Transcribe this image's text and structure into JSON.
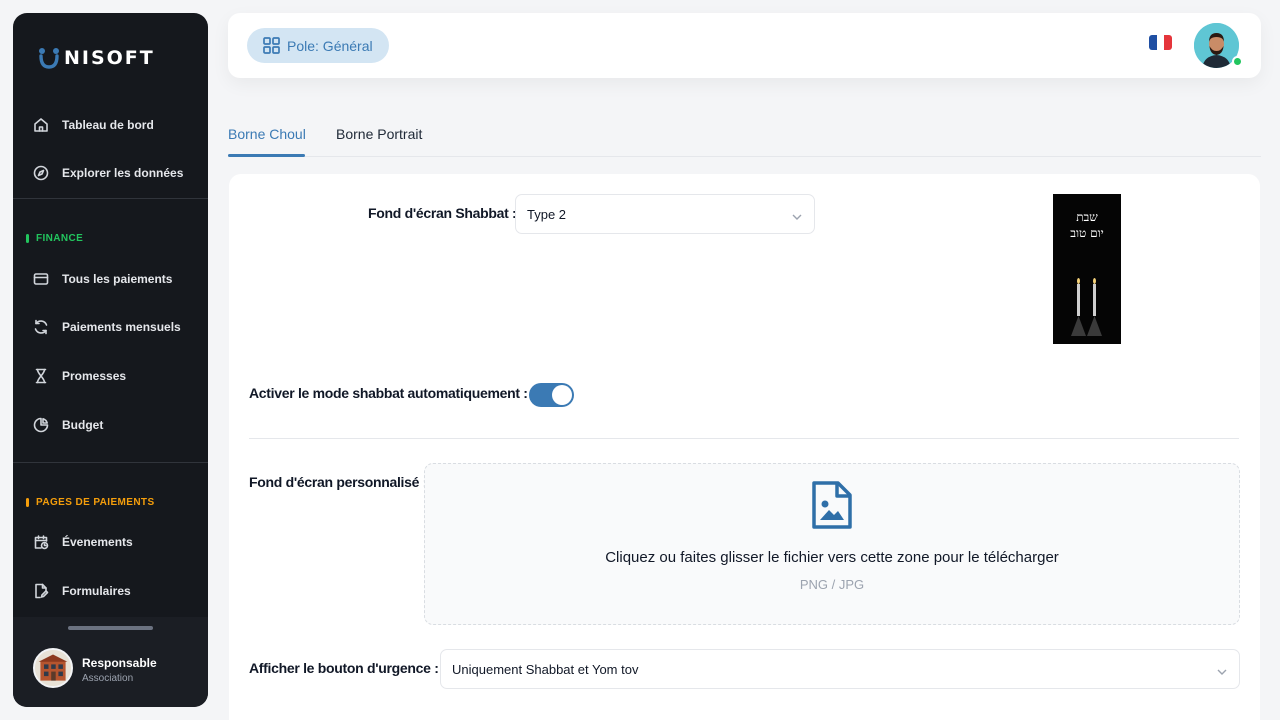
{
  "brand": {
    "name": "NISOFT",
    "accent": "#3b7ab4"
  },
  "sidebar": {
    "top_items": [
      {
        "label": "Tableau de bord",
        "icon": "home-icon"
      },
      {
        "label": "Explorer les données",
        "icon": "compass-icon"
      }
    ],
    "finance": {
      "title": "FINANCE",
      "items": [
        {
          "label": "Tous les paiements",
          "icon": "credit-card-icon"
        },
        {
          "label": "Paiements mensuels",
          "icon": "refresh-icon"
        },
        {
          "label": "Promesses",
          "icon": "hourglass-icon"
        },
        {
          "label": "Budget",
          "icon": "pie-chart-icon"
        }
      ]
    },
    "payment_pages": {
      "title": "PAGES DE PAIEMENTS",
      "items": [
        {
          "label": "Évenements",
          "icon": "calendar-clock-icon"
        },
        {
          "label": "Formulaires",
          "icon": "file-edit-icon"
        }
      ]
    },
    "user": {
      "name": "Responsable",
      "role": "Association"
    }
  },
  "header": {
    "pole_label": "Pole: Général",
    "language": "fr"
  },
  "tabs": [
    {
      "label": "Borne Choul",
      "active": true
    },
    {
      "label": "Borne Portrait",
      "active": false
    }
  ],
  "form": {
    "shabbat_wallpaper": {
      "label": "Fond d'écran Shabbat :",
      "value": "Type 2",
      "preview_text_1": "שבת",
      "preview_text_2": "יום טוב"
    },
    "auto_shabbat": {
      "label": "Activer le mode shabbat automatiquement :",
      "enabled": true
    },
    "custom_wallpaper": {
      "label": "Fond d'écran personnalisé :",
      "dropzone_text": "Cliquez ou faites glisser le fichier vers cette zone pour le télécharger",
      "formats": "PNG / JPG"
    },
    "urgency_button": {
      "label": "Afficher le bouton d'urgence :",
      "value": "Uniquement Shabbat et Yom tov"
    }
  }
}
